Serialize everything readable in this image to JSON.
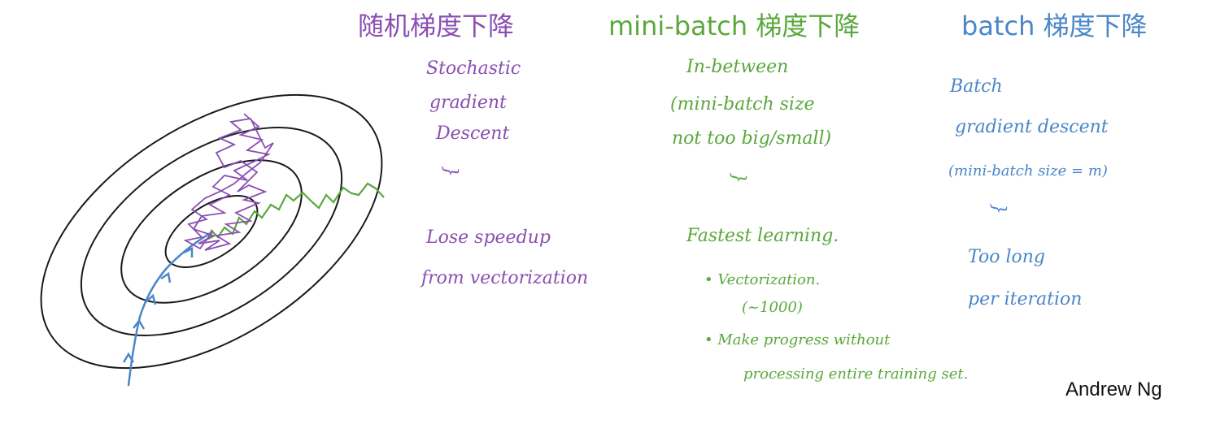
{
  "colors": {
    "stochastic": "#8a4fb2",
    "minibatch": "#5aa83c",
    "batch": "#4a86c8",
    "contour": "#1a1a1a"
  },
  "headings": {
    "stochastic": "随机梯度下降",
    "minibatch": "mini-batch 梯度下降",
    "batch": "batch 梯度下降"
  },
  "stochastic_notes": {
    "name_line1": "Stochastic",
    "name_line2": "gradient",
    "name_line3": "Descent",
    "brace": "}",
    "con_line1": "Lose speedup",
    "con_line2": "from vectorization"
  },
  "minibatch_notes": {
    "line1": "In-between",
    "line2": "(mini-batch size",
    "line3": "not too big/small)",
    "brace": "}",
    "result": "Fastest learning.",
    "bullet1": "• Vectorization.",
    "bullet1_sub": "(~1000)",
    "bullet2": "• Make progress without",
    "bullet2_sub": "processing entire training set."
  },
  "batch_notes": {
    "name_line1": "Batch",
    "name_line2": "gradient descent",
    "name_line3": "(mini-batch size = m)",
    "brace": "}",
    "con_line1": "Too long",
    "con_line2": "per iteration"
  },
  "credit": "Andrew Ng"
}
